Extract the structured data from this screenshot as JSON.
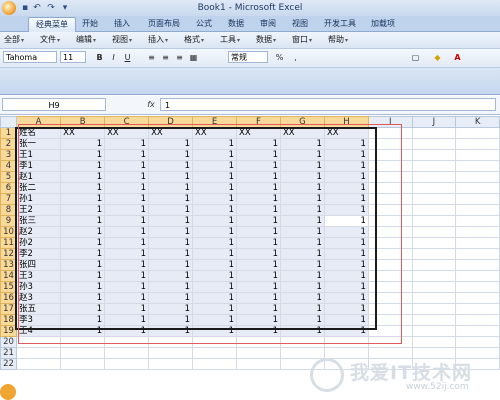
{
  "window": {
    "title": "Book1 - Microsoft Excel"
  },
  "ribbon_tabs": [
    "经典菜单",
    "开始",
    "插入",
    "页面布局",
    "公式",
    "数据",
    "审阅",
    "视图",
    "开发工具",
    "加载项"
  ],
  "menus": [
    "全部",
    "文件",
    "编辑",
    "视图",
    "插入",
    "格式",
    "工具",
    "数据",
    "窗口",
    "帮助"
  ],
  "toolbar": {
    "font_name": "Tahoma",
    "font_size": "11",
    "number_format": "常规",
    "bold": "B",
    "italic": "I",
    "underline": "U"
  },
  "formula_bar": {
    "name_box": "H9",
    "fx_label": "fx",
    "formula": "1"
  },
  "columns": [
    "A",
    "B",
    "C",
    "D",
    "E",
    "F",
    "G",
    "H",
    "I",
    "J",
    "K"
  ],
  "rows": [
    [
      "姓名",
      "XX",
      "XX",
      "XX",
      "XX",
      "XX",
      "XX",
      "XX"
    ],
    [
      "张一",
      "1",
      "1",
      "1",
      "1",
      "1",
      "1",
      "1"
    ],
    [
      "王1",
      "1",
      "1",
      "1",
      "1",
      "1",
      "1",
      "1"
    ],
    [
      "李1",
      "1",
      "1",
      "1",
      "1",
      "1",
      "1",
      "1"
    ],
    [
      "赵1",
      "1",
      "1",
      "1",
      "1",
      "1",
      "1",
      "1"
    ],
    [
      "张二",
      "1",
      "1",
      "1",
      "1",
      "1",
      "1",
      "1"
    ],
    [
      "孙1",
      "1",
      "1",
      "1",
      "1",
      "1",
      "1",
      "1"
    ],
    [
      "王2",
      "1",
      "1",
      "1",
      "1",
      "1",
      "1",
      "1"
    ],
    [
      "张三",
      "1",
      "1",
      "1",
      "1",
      "1",
      "1",
      "1"
    ],
    [
      "赵2",
      "1",
      "1",
      "1",
      "1",
      "1",
      "1",
      "1"
    ],
    [
      "孙2",
      "1",
      "1",
      "1",
      "1",
      "1",
      "1",
      "1"
    ],
    [
      "李2",
      "1",
      "1",
      "1",
      "1",
      "1",
      "1",
      "1"
    ],
    [
      "张四",
      "1",
      "1",
      "1",
      "1",
      "1",
      "1",
      "1"
    ],
    [
      "王3",
      "1",
      "1",
      "1",
      "1",
      "1",
      "1",
      "1"
    ],
    [
      "孙3",
      "1",
      "1",
      "1",
      "1",
      "1",
      "1",
      "1"
    ],
    [
      "赵3",
      "1",
      "1",
      "1",
      "1",
      "1",
      "1",
      "1"
    ],
    [
      "张五",
      "1",
      "1",
      "1",
      "1",
      "1",
      "1",
      "1"
    ],
    [
      "李3",
      "1",
      "1",
      "1",
      "1",
      "1",
      "1",
      "1"
    ],
    [
      "王4",
      "1",
      "1",
      "1",
      "1",
      "1",
      "1",
      "1"
    ],
    [
      "",
      "",
      "",
      "",
      "",
      "",
      "",
      ""
    ],
    [
      "",
      "",
      "",
      "",
      "",
      "",
      "",
      ""
    ],
    [
      "",
      "",
      "",
      "",
      "",
      "",
      "",
      ""
    ]
  ],
  "watermark": {
    "text": "我爱IT技术网",
    "url": "www.52ij.com"
  }
}
